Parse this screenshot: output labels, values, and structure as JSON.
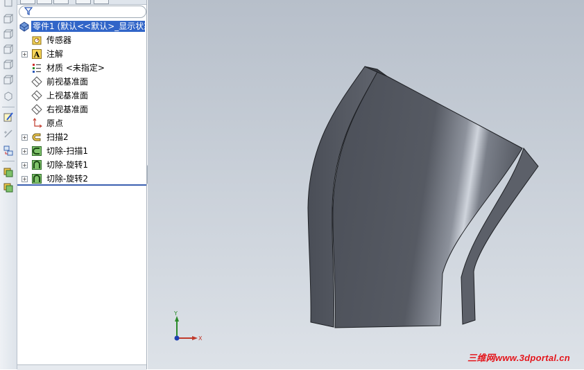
{
  "feature_tree": {
    "root": {
      "label": "零件1 (默认<<默认>_显示状态"
    },
    "items": [
      {
        "label": "传感器",
        "icon": "sensor-icon",
        "expandable": false
      },
      {
        "label": "注解",
        "icon": "annotation-icon",
        "expandable": true
      },
      {
        "label": "材质 <未指定>",
        "icon": "material-icon",
        "expandable": false
      },
      {
        "label": "前视基准面",
        "icon": "plane-icon",
        "expandable": false
      },
      {
        "label": "上视基准面",
        "icon": "plane-icon",
        "expandable": false
      },
      {
        "label": "右视基准面",
        "icon": "plane-icon",
        "expandable": false
      },
      {
        "label": "原点",
        "icon": "origin-icon",
        "expandable": false
      },
      {
        "label": "扫描2",
        "icon": "sweep-icon",
        "expandable": true
      },
      {
        "label": "切除-扫描1",
        "icon": "cut-sweep-icon",
        "expandable": true
      },
      {
        "label": "切除-旋转1",
        "icon": "cut-revolve-icon",
        "expandable": true
      },
      {
        "label": "切除-旋转2",
        "icon": "cut-revolve-icon",
        "expandable": true
      }
    ]
  },
  "triad": {
    "y_label": "Y",
    "x_label": "X"
  },
  "watermark": "三维网www.3dportal.cn",
  "colors": {
    "selection": "#3165c8",
    "part": "#50545d",
    "watermark": "#e4151b"
  }
}
